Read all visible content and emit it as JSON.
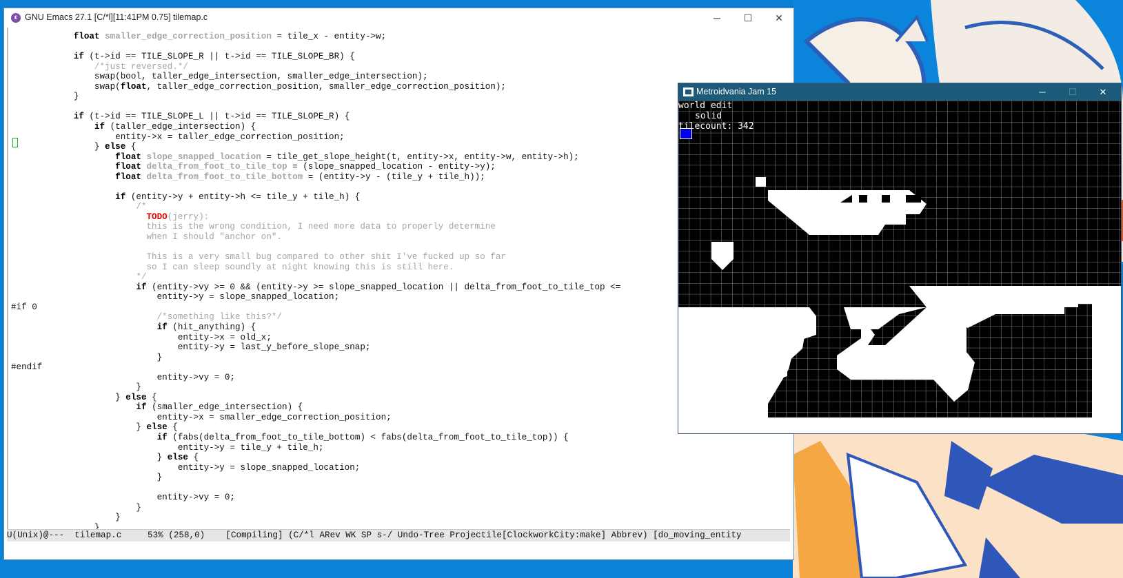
{
  "emacs": {
    "title": "GNU Emacs 27.1 [C/*l][11:41PM 0.75] tilemap.c",
    "icon": "emacs-logo-icon",
    "controls": {
      "minimize": "─",
      "maximize": "☐",
      "close": "✕"
    },
    "modeline": "U(Unix)@---  tilemap.c     53% (258,0)    [Compiling] (C/*l ARev WK SP s-/ Undo-Tree Projectile[ClockworkCity:make] Abbrev) [do_moving_entity"
  },
  "code_lines": [
    [
      {
        "t": "            "
      },
      {
        "t": "float",
        "c": "kw"
      },
      {
        "t": " "
      },
      {
        "t": "smaller_edge_correction_position",
        "c": "var"
      },
      {
        "t": " = tile_x - entity->w;"
      }
    ],
    [
      {
        "t": ""
      }
    ],
    [
      {
        "t": "            "
      },
      {
        "t": "if",
        "c": "kw"
      },
      {
        "t": " (t->id == TILE_SLOPE_R || t->id == TILE_SLOPE_BR) {"
      }
    ],
    [
      {
        "t": "                "
      },
      {
        "t": "/*just reversed.*/",
        "c": "cm"
      }
    ],
    [
      {
        "t": "                swap(bool, taller_edge_intersection, smaller_edge_intersection);"
      }
    ],
    [
      {
        "t": "                swap("
      },
      {
        "t": "float",
        "c": "kw"
      },
      {
        "t": ", taller_edge_correction_position, smaller_edge_correction_position);"
      }
    ],
    [
      {
        "t": "            }"
      }
    ],
    [
      {
        "t": ""
      }
    ],
    [
      {
        "t": "            "
      },
      {
        "t": "if",
        "c": "kw"
      },
      {
        "t": " (t->id == TILE_SLOPE_L || t->id == TILE_SLOPE_R) {"
      }
    ],
    [
      {
        "t": "                "
      },
      {
        "t": "if",
        "c": "kw"
      },
      {
        "t": " (taller_edge_intersection) {"
      }
    ],
    [
      {
        "t": "                    entity->x = taller_edge_correction_position;"
      }
    ],
    [
      {
        "t": "                } "
      },
      {
        "t": "else",
        "c": "kw"
      },
      {
        "t": " {"
      }
    ],
    [
      {
        "t": "                    "
      },
      {
        "t": "float",
        "c": "kw"
      },
      {
        "t": " "
      },
      {
        "t": "slope_snapped_location",
        "c": "var"
      },
      {
        "t": " = tile_get_slope_height(t, entity->x, entity->w, entity->h);"
      }
    ],
    [
      {
        "t": "                    "
      },
      {
        "t": "float",
        "c": "kw"
      },
      {
        "t": " "
      },
      {
        "t": "delta_from_foot_to_tile_top",
        "c": "var"
      },
      {
        "t": " = (slope_snapped_location - entity->y);"
      }
    ],
    [
      {
        "t": "                    "
      },
      {
        "t": "float",
        "c": "kw"
      },
      {
        "t": " "
      },
      {
        "t": "delta_from_foot_to_tile_bottom",
        "c": "var"
      },
      {
        "t": " = (entity->y - (tile_y + tile_h));"
      }
    ],
    [
      {
        "t": ""
      }
    ],
    [
      {
        "t": "                    "
      },
      {
        "t": "if",
        "c": "kw"
      },
      {
        "t": " (entity->y + entity->h <= tile_y + tile_h) {"
      }
    ],
    [
      {
        "t": "                        "
      },
      {
        "t": "/*",
        "c": "cm"
      }
    ],
    [
      {
        "t": "                          "
      },
      {
        "t": "TODO",
        "c": "todo"
      },
      {
        "t": "(jerry):",
        "c": "cm"
      }
    ],
    [
      {
        "t": "                          "
      },
      {
        "t": "this is the wrong condition, I need more data to properly determine",
        "c": "cm"
      }
    ],
    [
      {
        "t": "                          "
      },
      {
        "t": "when I should \"anchor on\".",
        "c": "cm"
      }
    ],
    [
      {
        "t": ""
      }
    ],
    [
      {
        "t": "                          "
      },
      {
        "t": "This is a very small bug compared to other shit I've fucked up so far",
        "c": "cm"
      }
    ],
    [
      {
        "t": "                          "
      },
      {
        "t": "so I can sleep soundly at night knowing this is still here.",
        "c": "cm"
      }
    ],
    [
      {
        "t": "                        "
      },
      {
        "t": "*/",
        "c": "cm"
      }
    ],
    [
      {
        "t": "                        "
      },
      {
        "t": "if",
        "c": "kw"
      },
      {
        "t": " (entity->vy >= 0 && (entity->y >= slope_snapped_location || delta_from_foot_to_tile_top <="
      }
    ],
    [
      {
        "t": "                            entity->y = slope_snapped_location;"
      }
    ],
    [
      {
        "t": "#if 0"
      }
    ],
    [
      {
        "t": "                            "
      },
      {
        "t": "/*something like this?*/",
        "c": "cm"
      }
    ],
    [
      {
        "t": "                            "
      },
      {
        "t": "if",
        "c": "kw"
      },
      {
        "t": " (hit_anything) {"
      }
    ],
    [
      {
        "t": "                                entity->x = old_x;"
      }
    ],
    [
      {
        "t": "                                entity->y = last_y_before_slope_snap;"
      }
    ],
    [
      {
        "t": "                            }"
      }
    ],
    [
      {
        "t": "#endif"
      }
    ],
    [
      {
        "t": "                            entity->vy = 0;"
      }
    ],
    [
      {
        "t": "                        }"
      }
    ],
    [
      {
        "t": "                    } "
      },
      {
        "t": "else",
        "c": "kw"
      },
      {
        "t": " {"
      }
    ],
    [
      {
        "t": "                        "
      },
      {
        "t": "if",
        "c": "kw"
      },
      {
        "t": " (smaller_edge_intersection) {"
      }
    ],
    [
      {
        "t": "                            entity->x = smaller_edge_correction_position;"
      }
    ],
    [
      {
        "t": "                        } "
      },
      {
        "t": "else",
        "c": "kw"
      },
      {
        "t": " {"
      }
    ],
    [
      {
        "t": "                            "
      },
      {
        "t": "if",
        "c": "kw"
      },
      {
        "t": " (fabs(delta_from_foot_to_tile_bottom) < fabs(delta_from_foot_to_tile_top)) {"
      }
    ],
    [
      {
        "t": "                                entity->y = tile_y + tile_h;"
      }
    ],
    [
      {
        "t": "                            } "
      },
      {
        "t": "else",
        "c": "kw"
      },
      {
        "t": " {"
      }
    ],
    [
      {
        "t": "                                entity->y = slope_snapped_location;"
      }
    ],
    [
      {
        "t": "                            }"
      }
    ],
    [
      {
        "t": ""
      }
    ],
    [
      {
        "t": "                            entity->vy = 0;"
      }
    ],
    [
      {
        "t": "                        }"
      }
    ],
    [
      {
        "t": "                    }"
      }
    ],
    [
      {
        "t": "                }"
      }
    ]
  ],
  "game": {
    "title": "Metroidvania Jam 15",
    "controls": {
      "minimize": "─",
      "maximize": "☐",
      "close": "✕"
    },
    "hud_mode": "world edit",
    "hud_tile": "solid",
    "hud_tilecount": "tilecount: 342",
    "swatch_color": "#0000ee"
  },
  "colors": {
    "desktop": "#0a80d6",
    "game_titlebar": "#1b5a78",
    "comment": "#a6a6a6",
    "todo": "#e00000"
  }
}
